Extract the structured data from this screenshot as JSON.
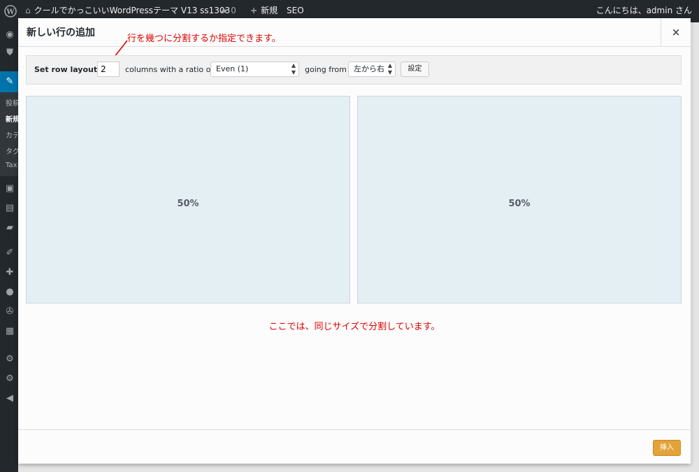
{
  "admin_bar": {
    "site_title": "クールでかっこいいWordPressテーマ V13 ss1303",
    "comments_count": "0",
    "new_label": "新規",
    "seo_label": "SEO",
    "howdy": "こんにちは、admin さん"
  },
  "sidebar": {
    "items": [
      "投稿",
      "新規",
      "カテ",
      "タグ",
      "Tax"
    ]
  },
  "modal": {
    "title": "新しい行の追加",
    "close_symbol": "×",
    "annotation_top": "行を幾つに分割するか指定できます。",
    "annotation_bottom": "ここでは、同じサイズで分割しています。",
    "toolbar": {
      "set_row_layout_label": "Set row layout :",
      "columns_value": "2",
      "columns_label": "columns with a ratio of",
      "ratio_value": "Even (1)",
      "going_from_label": "going from",
      "direction_value": "左から右",
      "set_button_label": "設定"
    },
    "columns": [
      {
        "percent": "50%"
      },
      {
        "percent": "50%"
      }
    ],
    "insert_button_label": "挿入"
  },
  "colors": {
    "annotation": "#e00000",
    "insert_button": "#e3a33a",
    "column_fill": "#e4eff4",
    "admin_bar": "#23282d"
  }
}
